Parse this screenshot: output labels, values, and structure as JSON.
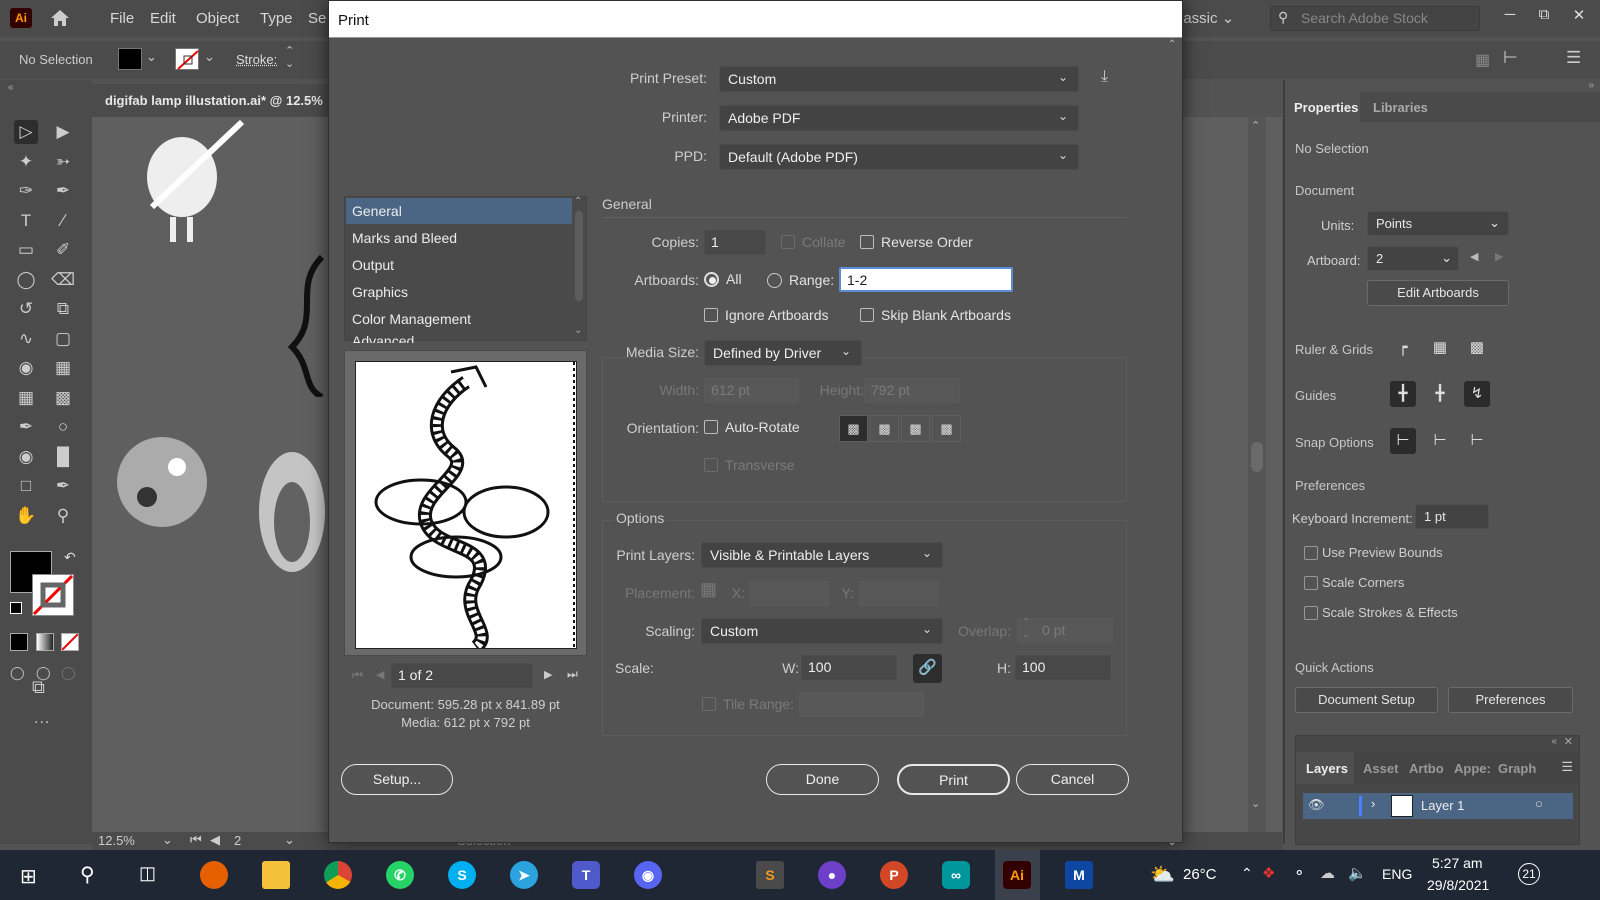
{
  "app": {
    "logo": "Ai",
    "menu": [
      "File",
      "Edit",
      "Object",
      "Type",
      "Se"
    ],
    "workspace": "lassic",
    "stock_search_placeholder": "Search Adobe Stock",
    "window_controls": [
      "minimize",
      "restore",
      "close"
    ]
  },
  "control_bar": {
    "selection_label": "No Selection",
    "stroke_label": "Stroke:"
  },
  "document_tab": {
    "title": "digifab lamp illustation.ai* @ 12.5%"
  },
  "status_bar": {
    "zoom": "12.5%",
    "artboard": "2",
    "tool": "Selection"
  },
  "toolbar": {
    "tools": [
      "selection-tool",
      "direct-selection-tool",
      "magic-wand-tool",
      "lasso-tool",
      "pen-tool",
      "curvature-tool",
      "type-tool",
      "line-segment-tool",
      "rectangle-tool",
      "paintbrush-tool",
      "shaper-tool",
      "eraser-tool",
      "rotate-tool",
      "scale-tool",
      "puppet-warp-tool",
      "free-transform-tool",
      "shape-builder-tool",
      "perspective-grid-tool",
      "mesh-tool",
      "gradient-tool",
      "eyedropper-tool",
      "blend-tool",
      "symbol-sprayer-tool",
      "column-graph-tool",
      "artboard-tool",
      "slice-tool",
      "hand-tool",
      "zoom-tool"
    ],
    "more": "..."
  },
  "print_dialog": {
    "title": "Print",
    "print_preset": {
      "label": "Print Preset:",
      "value": "Custom"
    },
    "printer": {
      "label": "Printer:",
      "value": "Adobe PDF"
    },
    "ppd": {
      "label": "PPD:",
      "value": "Default (Adobe PDF)"
    },
    "categories": [
      "General",
      "Marks and Bleed",
      "Output",
      "Graphics",
      "Color Management",
      "Advanced"
    ],
    "selected_category": "General",
    "section_title": "General",
    "copies": {
      "label": "Copies:",
      "value": "1"
    },
    "collate": {
      "label": "Collate",
      "checked": false,
      "disabled": true
    },
    "reverse_order": {
      "label": "Reverse Order",
      "checked": false
    },
    "artboards": {
      "label": "Artboards:",
      "all_label": "All",
      "range_label": "Range:",
      "selected": "All",
      "range_value": "1-2"
    },
    "ignore_artboards": {
      "label": "Ignore Artboards",
      "checked": false
    },
    "skip_blank": {
      "label": "Skip Blank Artboards",
      "checked": false
    },
    "media_size": {
      "label": "Media Size:",
      "value": "Defined by Driver"
    },
    "width": {
      "label": "Width:",
      "value": "612 pt"
    },
    "height": {
      "label": "Height:",
      "value": "792 pt"
    },
    "orientation": {
      "label": "Orientation:",
      "auto_rotate_label": "Auto-Rotate",
      "auto_rotate": false,
      "options": [
        "portrait",
        "landscape",
        "portrait-flipped",
        "landscape-flipped"
      ],
      "selected": "portrait"
    },
    "transverse": {
      "label": "Transverse",
      "checked": false,
      "disabled": true
    },
    "options_title": "Options",
    "print_layers": {
      "label": "Print Layers:",
      "value": "Visible & Printable Layers"
    },
    "placement": {
      "label": "Placement:",
      "x_label": "X:",
      "y_label": "Y:",
      "x_value": "",
      "y_value": ""
    },
    "scaling": {
      "label": "Scaling:",
      "value": "Custom"
    },
    "overlap": {
      "label": "Overlap:",
      "value": "0 pt"
    },
    "scale": {
      "label": "Scale:",
      "w_label": "W:",
      "w_value": "100",
      "h_label": "H:",
      "h_value": "100"
    },
    "tile_range": {
      "label": "Tile Range:",
      "value": ""
    },
    "page_nav": {
      "value": "1 of 2"
    },
    "document_info": "Document: 595.28 pt x 841.89 pt",
    "media_info": "Media: 612 pt x 792 pt",
    "buttons": {
      "setup": "Setup...",
      "done": "Done",
      "print": "Print",
      "cancel": "Cancel"
    }
  },
  "properties_panel": {
    "tabs": [
      "Properties",
      "Libraries"
    ],
    "active_tab": "Properties",
    "selection": "No Selection",
    "document_title": "Document",
    "units": {
      "label": "Units:",
      "value": "Points"
    },
    "artboard": {
      "label": "Artboard:",
      "value": "2"
    },
    "edit_artboards": "Edit Artboards",
    "ruler_grids": "Ruler & Grids",
    "guides": "Guides",
    "snap_options": "Snap Options",
    "preferences_title": "Preferences",
    "keyboard_increment": {
      "label": "Keyboard Increment:",
      "value": "1 pt"
    },
    "checkboxes": [
      {
        "label": "Use Preview Bounds",
        "checked": false
      },
      {
        "label": "Scale Corners",
        "checked": false
      },
      {
        "label": "Scale Strokes & Effects",
        "checked": false
      }
    ],
    "quick_actions_title": "Quick Actions",
    "quick_actions": [
      "Document Setup",
      "Preferences"
    ]
  },
  "layers_panel": {
    "tabs": [
      "Layers",
      "Asset",
      "Artbo",
      "Appe:",
      "Graph"
    ],
    "active_tab": "Layers",
    "layers": [
      {
        "name": "Layer 1",
        "visible": true
      }
    ]
  },
  "taskbar": {
    "apps": [
      "Firefox",
      "File Explorer",
      "Chrome",
      "WhatsApp",
      "Skype",
      "Telegram",
      "Teams",
      "Discord",
      "Sublime Text",
      "GitHub Desktop",
      "PowerPoint",
      "Arduino",
      "Illustrator",
      "Mendeley"
    ],
    "weather": "26°C",
    "language": "ENG",
    "time": "5:27 am",
    "date": "29/8/2021",
    "notifications": "21"
  },
  "colors": {
    "accent_selected": "#4b6584",
    "dialog_bg": "#535353",
    "taskbar_bg": "#202734",
    "illustrator_orange": "#ff9a00"
  }
}
